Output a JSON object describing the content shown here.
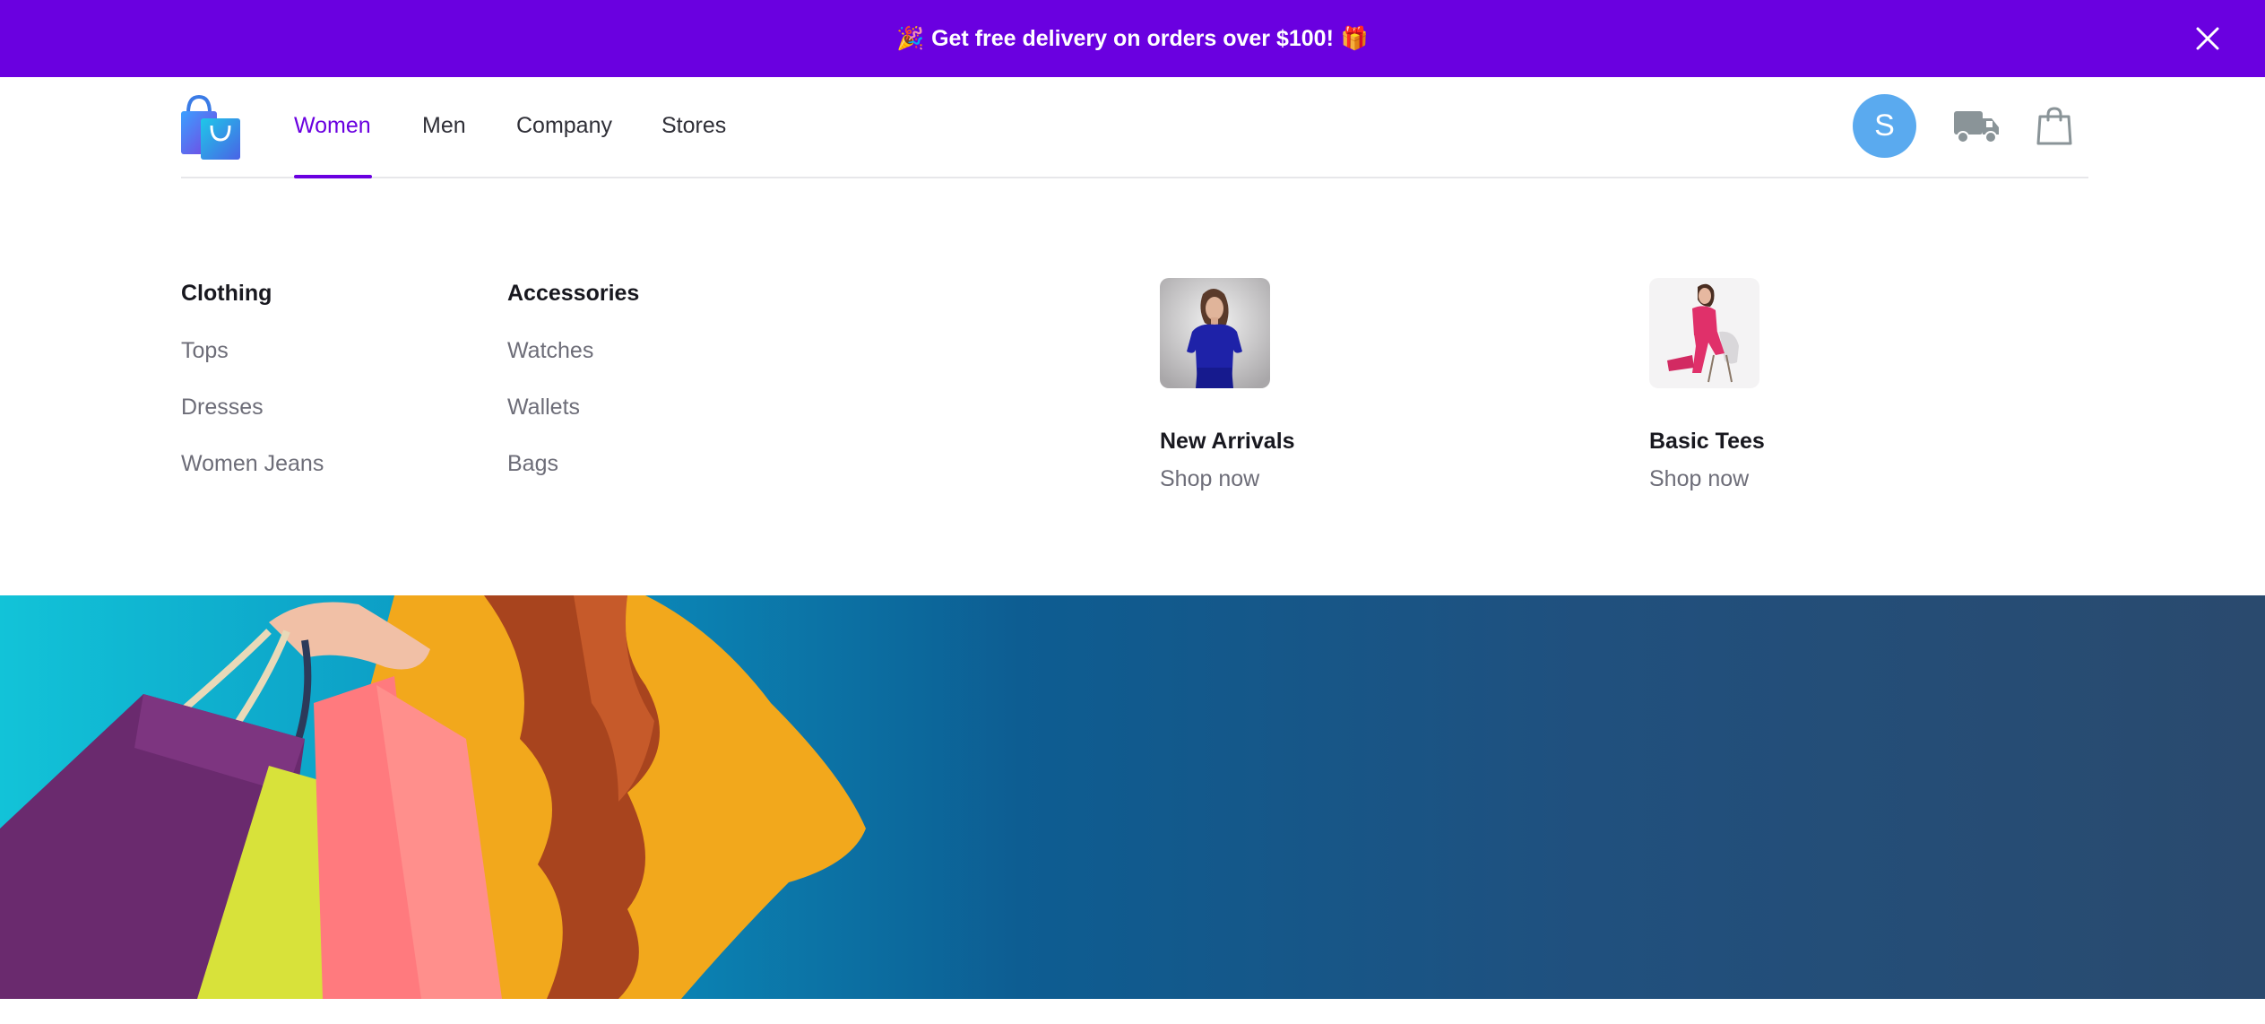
{
  "promo_banner": {
    "emoji_left": "🎉",
    "text": "Get free delivery on orders over $100!",
    "emoji_right": "🎁",
    "background": "#6a00e0"
  },
  "header": {
    "logo_icon": "shopping-bag-logo-icon",
    "nav": [
      {
        "label": "Women",
        "active": true
      },
      {
        "label": "Men",
        "active": false
      },
      {
        "label": "Company",
        "active": false
      },
      {
        "label": "Stores",
        "active": false
      }
    ],
    "avatar_initial": "S",
    "avatar_color": "#5aaaef",
    "truck_icon": "delivery-truck-icon",
    "cart_icon": "shopping-bag-icon",
    "accent_color": "#6a00e0"
  },
  "menu": {
    "columns": [
      {
        "title": "Clothing",
        "links": [
          "Tops",
          "Dresses",
          "Women Jeans"
        ]
      },
      {
        "title": "Accessories",
        "links": [
          "Watches",
          "Wallets",
          "Bags"
        ]
      }
    ],
    "featured": [
      {
        "title": "New Arrivals",
        "cta": "Shop now"
      },
      {
        "title": "Basic Tees",
        "cta": "Shop now"
      }
    ]
  }
}
